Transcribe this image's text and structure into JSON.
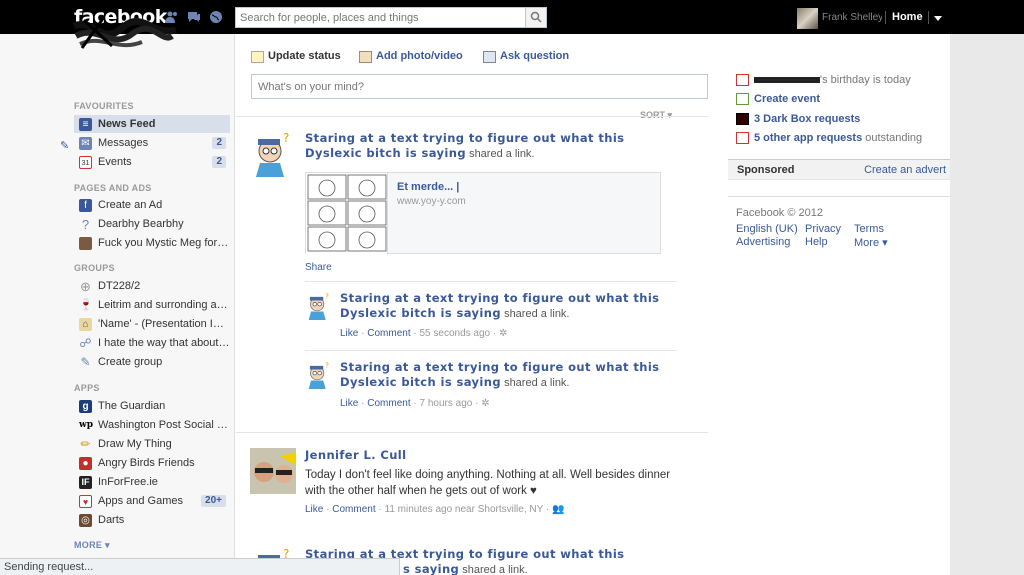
{
  "topbar": {
    "logo": "facebook",
    "search_placeholder": "Search for people, places and things",
    "user_name": "Frank Shelley",
    "home": "Home"
  },
  "left": {
    "favourites_header": "FAVOURITES",
    "favourites": [
      {
        "label": "News Feed",
        "selected": true
      },
      {
        "label": "Messages",
        "count": "2"
      },
      {
        "label": "Events",
        "count": "2"
      }
    ],
    "pages_header": "PAGES AND ADS",
    "pages": [
      {
        "label": "Create an Ad"
      },
      {
        "label": "Dearbhy Bearbhy"
      },
      {
        "label": "Fuck you Mystic Meg for clo..."
      }
    ],
    "groups_header": "GROUPS",
    "groups": [
      {
        "label": "DT228/2"
      },
      {
        "label": "Leitrim and surronding area..."
      },
      {
        "label": "'Name' - (Presentation INfo..."
      },
      {
        "label": "I hate the way that about ..."
      },
      {
        "label": "Create group"
      }
    ],
    "apps_header": "APPS",
    "apps": [
      {
        "label": "The Guardian"
      },
      {
        "label": "Washington Post Social Rea..."
      },
      {
        "label": "Draw My Thing"
      },
      {
        "label": "Angry Birds Friends"
      },
      {
        "label": "InForFree.ie"
      },
      {
        "label": "Apps and Games",
        "count": "20+"
      },
      {
        "label": "Darts"
      }
    ],
    "more": "MORE"
  },
  "composer": {
    "update_status": "Update status",
    "add_photo": "Add photo/video",
    "ask_question": "Ask question",
    "placeholder": "What's on your mind?"
  },
  "feed": {
    "sort": "SORT",
    "story1": {
      "name": "Staring at a text trying to figure out what this Dyslexic bitch is saying",
      "action": "shared a link.",
      "link_title": "Et merde... |",
      "link_url": "www.yoy-y.com",
      "share": "Share",
      "sub": [
        {
          "name": "Staring at a text trying to figure out what this Dyslexic bitch is saying",
          "action": "shared a link.",
          "like": "Like",
          "comment": "Comment",
          "time": "55 seconds ago"
        },
        {
          "name": "Staring at a text trying to figure out what this Dyslexic bitch is saying",
          "action": "shared a link.",
          "like": "Like",
          "comment": "Comment",
          "time": "7 hours ago"
        }
      ]
    },
    "story2": {
      "name": "Jennifer L. Cull",
      "message": "Today I don't feel like doing anything. Nothing at all. Well besides dinner with the other half when he gets out of work ♥",
      "like": "Like",
      "comment": "Comment",
      "time": "11 minutes ago near Shortsville, NY"
    },
    "story3": {
      "name_line1": "Staring at a text trying to figure out what this",
      "name_line2": "s saying",
      "action": "shared a link."
    }
  },
  "right": {
    "birthday_suffix": "'s birthday is today",
    "create_event": "Create event",
    "dark_box": "3 Dark Box requests",
    "app_requests": "5 other app requests",
    "app_requests_suffix": "outstanding",
    "sponsored": "Sponsored",
    "create_advert": "Create an advert",
    "copyright": "Facebook © 2012",
    "footer": {
      "english": "English (UK)",
      "privacy": "Privacy",
      "terms": "Terms",
      "advertising": "Advertising",
      "help": "Help",
      "more": "More"
    }
  },
  "status_bar": "Sending request..."
}
